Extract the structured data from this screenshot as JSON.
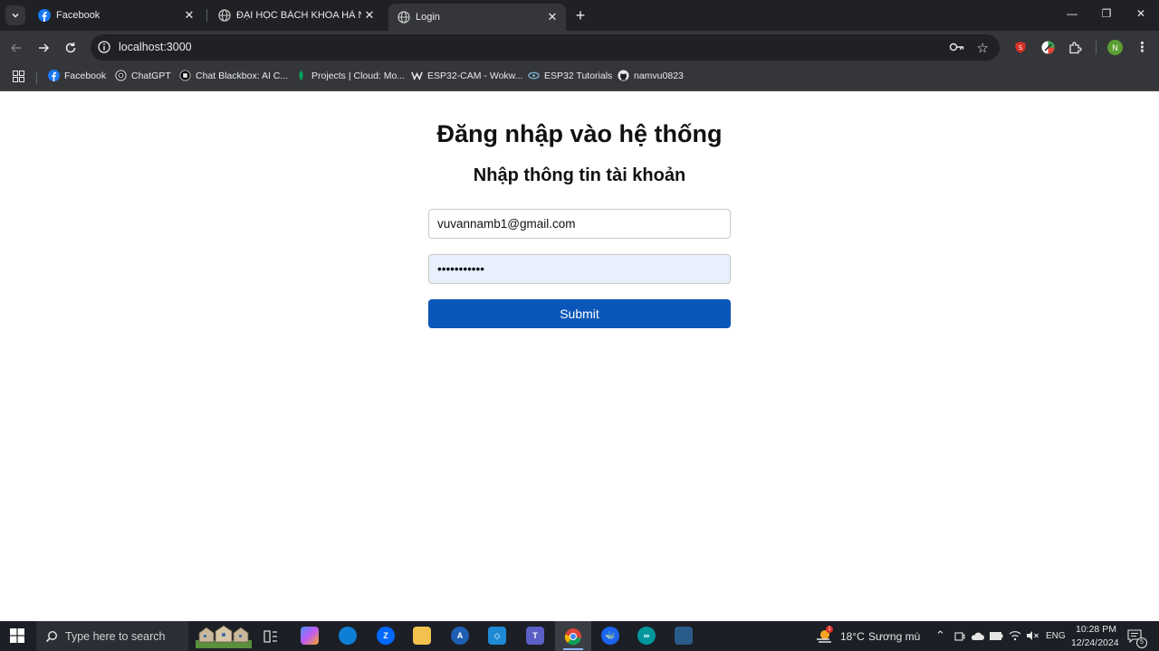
{
  "browser": {
    "tabs": [
      {
        "title": "Facebook",
        "close": "✕"
      },
      {
        "title": "ĐẠI HỌC BÁCH KHOA HÀ NỘI.",
        "close": "✕"
      },
      {
        "title": "Login",
        "close": "✕"
      }
    ],
    "new_tab": "+",
    "window_controls": {
      "minimize": "—",
      "restore": "❐",
      "close": "✕"
    },
    "address": "localhost:3000",
    "profile_initial": "N",
    "bookmarks": [
      {
        "label": "Facebook"
      },
      {
        "label": "ChatGPT"
      },
      {
        "label": "Chat Blackbox: AI C..."
      },
      {
        "label": "Projects | Cloud: Mo..."
      },
      {
        "label": "ESP32-CAM - Wokw..."
      },
      {
        "label": "ESP32 Tutorials"
      },
      {
        "label": "namvu0823"
      }
    ]
  },
  "page": {
    "heading": "Đăng nhập vào hệ thống",
    "subheading": "Nhập thông tin tài khoản",
    "email_value": "vuvannamb1@gmail.com",
    "password_masked": "•••••••••••",
    "submit_label": "Submit"
  },
  "taskbar": {
    "search_placeholder": "Type here to search",
    "weather_temp": "18°C",
    "weather_desc": "Sương mù",
    "weather_badge": "1",
    "language": "ENG",
    "time": "10:28 PM",
    "date": "12/24/2024",
    "notification_count": "5"
  },
  "colors": {
    "accent": "#0b57b9",
    "chrome_dark": "#202124",
    "chrome_toolbar": "#35363a",
    "autofill": "#e8f0fe"
  }
}
